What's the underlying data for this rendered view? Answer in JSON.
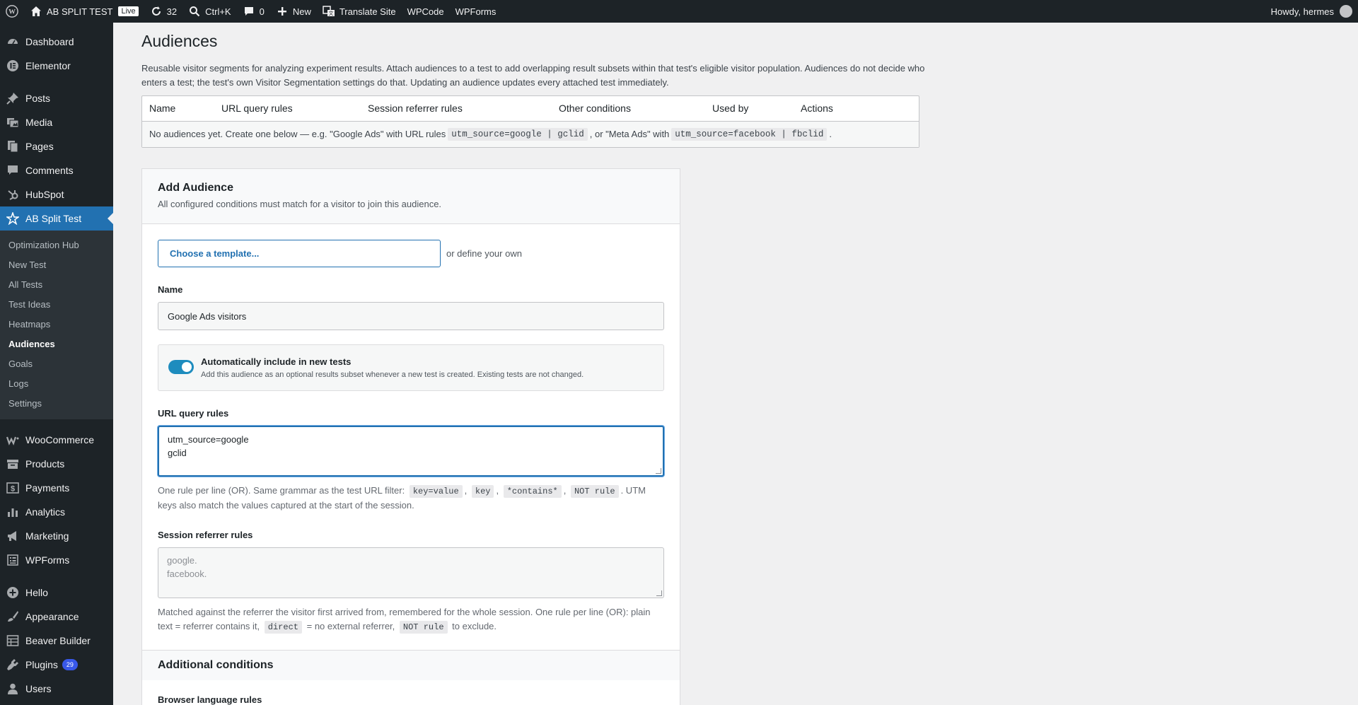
{
  "adminbar": {
    "site_name": "AB SPLIT TEST",
    "live_label": "Live",
    "updates_count": "32",
    "search_shortcut": "Ctrl+K",
    "comments_count": "0",
    "new_label": "New",
    "translate_label": "Translate Site",
    "wpcode_label": "WPCode",
    "wpforms_label": "WPForms",
    "howdy": "Howdy, hermes"
  },
  "sidebar": {
    "items_top": [
      {
        "label": "Dashboard",
        "icon": "dashboard-icon"
      },
      {
        "label": "Elementor",
        "icon": "elementor-icon"
      }
    ],
    "items_content": [
      {
        "label": "Posts",
        "icon": "pin-icon"
      },
      {
        "label": "Media",
        "icon": "media-icon"
      },
      {
        "label": "Pages",
        "icon": "pages-icon"
      },
      {
        "label": "Comments",
        "icon": "comment-icon"
      },
      {
        "label": "HubSpot",
        "icon": "hubspot-icon"
      }
    ],
    "active": {
      "label": "AB Split Test",
      "icon": "star-icon"
    },
    "submenu": [
      "Optimization Hub",
      "New Test",
      "All Tests",
      "Test Ideas",
      "Heatmaps",
      "Audiences",
      "Goals",
      "Logs",
      "Settings"
    ],
    "submenu_current": "Audiences",
    "items_commerce": [
      {
        "label": "WooCommerce",
        "icon": "woo-icon"
      },
      {
        "label": "Products",
        "icon": "archive-icon"
      },
      {
        "label": "Payments",
        "icon": "dollar-icon"
      },
      {
        "label": "Analytics",
        "icon": "chart-icon"
      },
      {
        "label": "Marketing",
        "icon": "megaphone-icon"
      },
      {
        "label": "WPForms",
        "icon": "forms-icon"
      }
    ],
    "items_bottom": [
      {
        "label": "Hello",
        "icon": "plus-circle-icon"
      },
      {
        "label": "Appearance",
        "icon": "brush-icon"
      },
      {
        "label": "Beaver Builder",
        "icon": "grid-icon"
      },
      {
        "label": "Plugins",
        "icon": "plug-icon",
        "badge": "29"
      },
      {
        "label": "Users",
        "icon": "user-icon"
      }
    ]
  },
  "page": {
    "title": "Audiences",
    "intro": "Reusable visitor segments for analyzing experiment results. Attach audiences to a test to add overlapping result subsets within that test's eligible visitor population. Audiences do not decide who enters a test; the test's own Visitor Segmentation settings do that. Updating an audience updates every attached test immediately."
  },
  "table": {
    "headers": [
      "Name",
      "URL query rules",
      "Session referrer rules",
      "Other conditions",
      "Used by",
      "Actions"
    ],
    "empty_prefix": "No audiences yet. Create one below — e.g. \"Google Ads\" with URL rules",
    "example1_code": "utm_source=google | gclid",
    "empty_middle": ", or \"Meta Ads\" with",
    "example2_code": "utm_source=facebook | fbclid",
    "empty_suffix": "."
  },
  "form": {
    "title": "Add Audience",
    "subtitle": "All configured conditions must match for a visitor to join this audience.",
    "template_button": "Choose a template...",
    "template_or": "or define your own",
    "name_label": "Name",
    "name_value": "Google Ads visitors",
    "auto_include_title": "Automatically include in new tests",
    "auto_include_desc": "Add this audience as an optional results subset whenever a new test is created. Existing tests are not changed.",
    "auto_include_on": true,
    "url_rules_label": "URL query rules",
    "url_rules_value": "utm_source=google\ngclid",
    "url_help_1": "One rule per line (OR). Same grammar as the test URL filter:",
    "url_code_1": "key=value",
    "url_code_2": "key",
    "url_code_3": "*contains*",
    "url_code_4": "NOT rule",
    "url_help_2": ". UTM keys also match the values captured at the start of the session.",
    "referrer_label": "Session referrer rules",
    "referrer_placeholder": "google.\nfacebook.",
    "ref_help_1": "Matched against the referrer the visitor first arrived from, remembered for the whole session. One rule per line (OR): plain text = referrer contains it,",
    "ref_code_1": "direct",
    "ref_help_2": "= no external referrer,",
    "ref_code_2": "NOT rule",
    "ref_help_3": "to exclude.",
    "additional_title": "Additional conditions",
    "browser_lang_label": "Browser language rules"
  },
  "colors": {
    "adminbar_bg": "#1d2327",
    "accent": "#2271b1",
    "content_bg": "#f0f0f1"
  }
}
